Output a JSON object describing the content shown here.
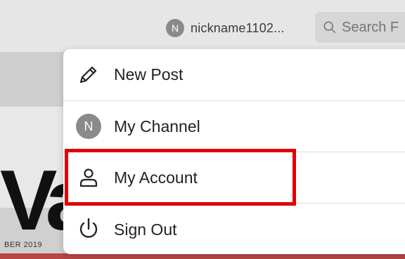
{
  "header": {
    "user": {
      "avatar_initial": "N",
      "name": "nickname1102..."
    },
    "search": {
      "placeholder": "Search F"
    }
  },
  "background": {
    "hero_word": "Va",
    "hero_date": "BER 2019"
  },
  "menu": {
    "items": [
      {
        "label": "New Post",
        "icon": "pencil-icon"
      },
      {
        "label": "My Channel",
        "icon": "avatar",
        "avatar_initial": "N"
      },
      {
        "label": "My Account",
        "icon": "user-icon"
      },
      {
        "label": "Sign Out",
        "icon": "power-icon"
      }
    ]
  },
  "colors": {
    "highlight": "#e00000",
    "avatar": "#8a8a8a",
    "topbar": "#e6e6e6"
  }
}
